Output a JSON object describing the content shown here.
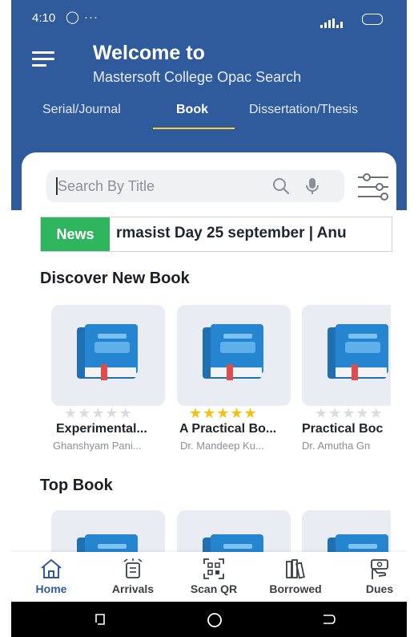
{
  "status_bar": {
    "time": "4:10",
    "indicators": "◯ ···"
  },
  "header": {
    "welcome": "Welcome to",
    "subtitle": "Mastersoft College Opac Search"
  },
  "tabs": [
    {
      "label": "Serial/Journal",
      "active": false
    },
    {
      "label": "Book",
      "active": true
    },
    {
      "label": "Dissertation/Thesis",
      "active": false
    }
  ],
  "search": {
    "placeholder": "Search By Title"
  },
  "news": {
    "tag": "News",
    "ticker": "rmasist Day 25 september | Anu"
  },
  "sections": {
    "discover_title": "Discover New Book",
    "top_title": "Top Book"
  },
  "discover_books": [
    {
      "title": "Experimental...",
      "author": "Ghanshyam Pani...",
      "rating": 0
    },
    {
      "title": "A Practical Bo...",
      "author": "Dr. Mandeep Ku...",
      "rating": 5
    },
    {
      "title": "Practical Boc",
      "author": "Dr. Amutha Gn",
      "rating": 0
    }
  ],
  "bottom_nav": [
    {
      "label": "Home",
      "icon": "home-icon",
      "active": true
    },
    {
      "label": "Arrivals",
      "icon": "arrivals-icon",
      "active": false
    },
    {
      "label": "Scan QR",
      "icon": "qr-icon",
      "active": false
    },
    {
      "label": "Borrowed",
      "icon": "books-icon",
      "active": false
    },
    {
      "label": "Dues",
      "icon": "dues-icon",
      "active": false
    }
  ],
  "colors": {
    "header": "#2f5b9c",
    "accent_underline": "#f4d03f",
    "news_tag": "#2fb55e",
    "star_filled": "#f4c20d",
    "star_empty": "#d9dce1"
  }
}
